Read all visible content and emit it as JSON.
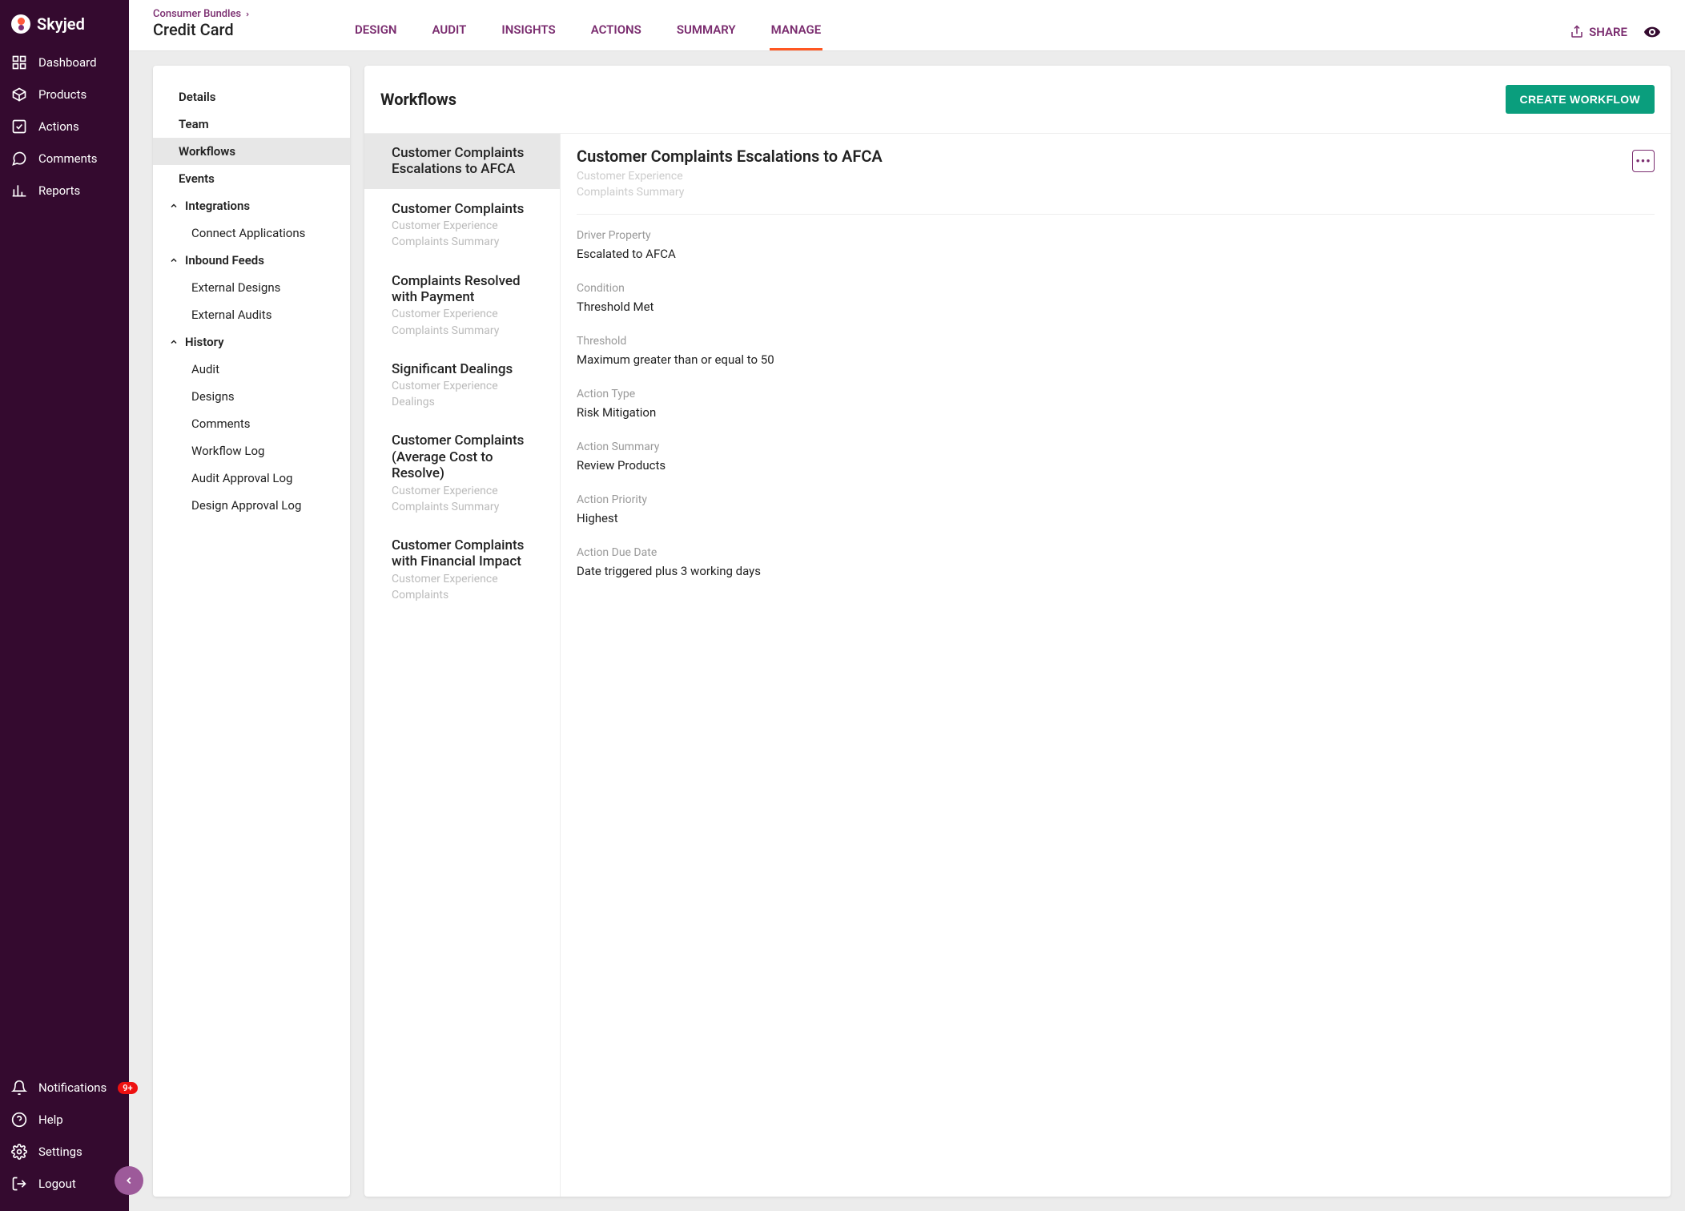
{
  "brand": "Skyjed",
  "sidebar": {
    "items": [
      {
        "label": "Dashboard",
        "icon": "dashboard"
      },
      {
        "label": "Products",
        "icon": "products"
      },
      {
        "label": "Actions",
        "icon": "actions"
      },
      {
        "label": "Comments",
        "icon": "comments"
      },
      {
        "label": "Reports",
        "icon": "reports"
      }
    ],
    "bottom": [
      {
        "label": "Notifications",
        "icon": "bell",
        "badge": "9+"
      },
      {
        "label": "Help",
        "icon": "help"
      },
      {
        "label": "Settings",
        "icon": "settings"
      },
      {
        "label": "Logout",
        "icon": "logout"
      }
    ]
  },
  "topbar": {
    "crumb": "Consumer Bundles",
    "title": "Credit Card",
    "tabs": [
      "DESIGN",
      "AUDIT",
      "INSIGHTS",
      "ACTIONS",
      "SUMMARY",
      "MANAGE"
    ],
    "activeTab": "MANAGE",
    "share": "SHARE"
  },
  "leftPanel": {
    "items": [
      {
        "label": "Details",
        "type": "item"
      },
      {
        "label": "Team",
        "type": "item"
      },
      {
        "label": "Workflows",
        "type": "item",
        "active": true
      },
      {
        "label": "Events",
        "type": "item"
      },
      {
        "label": "Integrations",
        "type": "head"
      },
      {
        "label": "Connect Applications",
        "type": "sub"
      },
      {
        "label": "Inbound Feeds",
        "type": "head"
      },
      {
        "label": "External Designs",
        "type": "sub"
      },
      {
        "label": "External Audits",
        "type": "sub"
      },
      {
        "label": "History",
        "type": "head"
      },
      {
        "label": "Audit",
        "type": "sub"
      },
      {
        "label": "Designs",
        "type": "sub"
      },
      {
        "label": "Comments",
        "type": "sub"
      },
      {
        "label": "Workflow Log",
        "type": "sub"
      },
      {
        "label": "Audit Approval Log",
        "type": "sub"
      },
      {
        "label": "Design Approval Log",
        "type": "sub"
      }
    ]
  },
  "workflows": {
    "heading": "Workflows",
    "createBtn": "CREATE WORKFLOW",
    "list": [
      {
        "title": "Customer Complaints Escalations to AFCA",
        "sub1": "",
        "sub2": "",
        "active": true
      },
      {
        "title": "Customer Complaints",
        "sub1": "Customer Experience",
        "sub2": "Complaints Summary"
      },
      {
        "title": "Complaints Resolved with Payment",
        "sub1": "Customer Experience",
        "sub2": "Complaints Summary"
      },
      {
        "title": "Significant Dealings",
        "sub1": "Customer Experience",
        "sub2": "Dealings"
      },
      {
        "title": "Customer Complaints (Average Cost to Resolve)",
        "sub1": "Customer Experience",
        "sub2": "Complaints Summary"
      },
      {
        "title": "Customer Complaints with Financial Impact",
        "sub1": "Customer Experience",
        "sub2": "Complaints"
      }
    ],
    "detail": {
      "title": "Customer Complaints Escalations to AFCA",
      "sub1": "Customer Experience",
      "sub2": "Complaints Summary",
      "fields": [
        {
          "label": "Driver Property",
          "value": "Escalated to AFCA"
        },
        {
          "label": "Condition",
          "value": "Threshold Met"
        },
        {
          "label": "Threshold",
          "value": "Maximum greater than or equal to 50"
        },
        {
          "label": "Action Type",
          "value": "Risk Mitigation"
        },
        {
          "label": "Action Summary",
          "value": "Review Products"
        },
        {
          "label": "Action Priority",
          "value": "Highest"
        },
        {
          "label": "Action Due Date",
          "value": "Date triggered plus 3 working days"
        }
      ]
    }
  }
}
